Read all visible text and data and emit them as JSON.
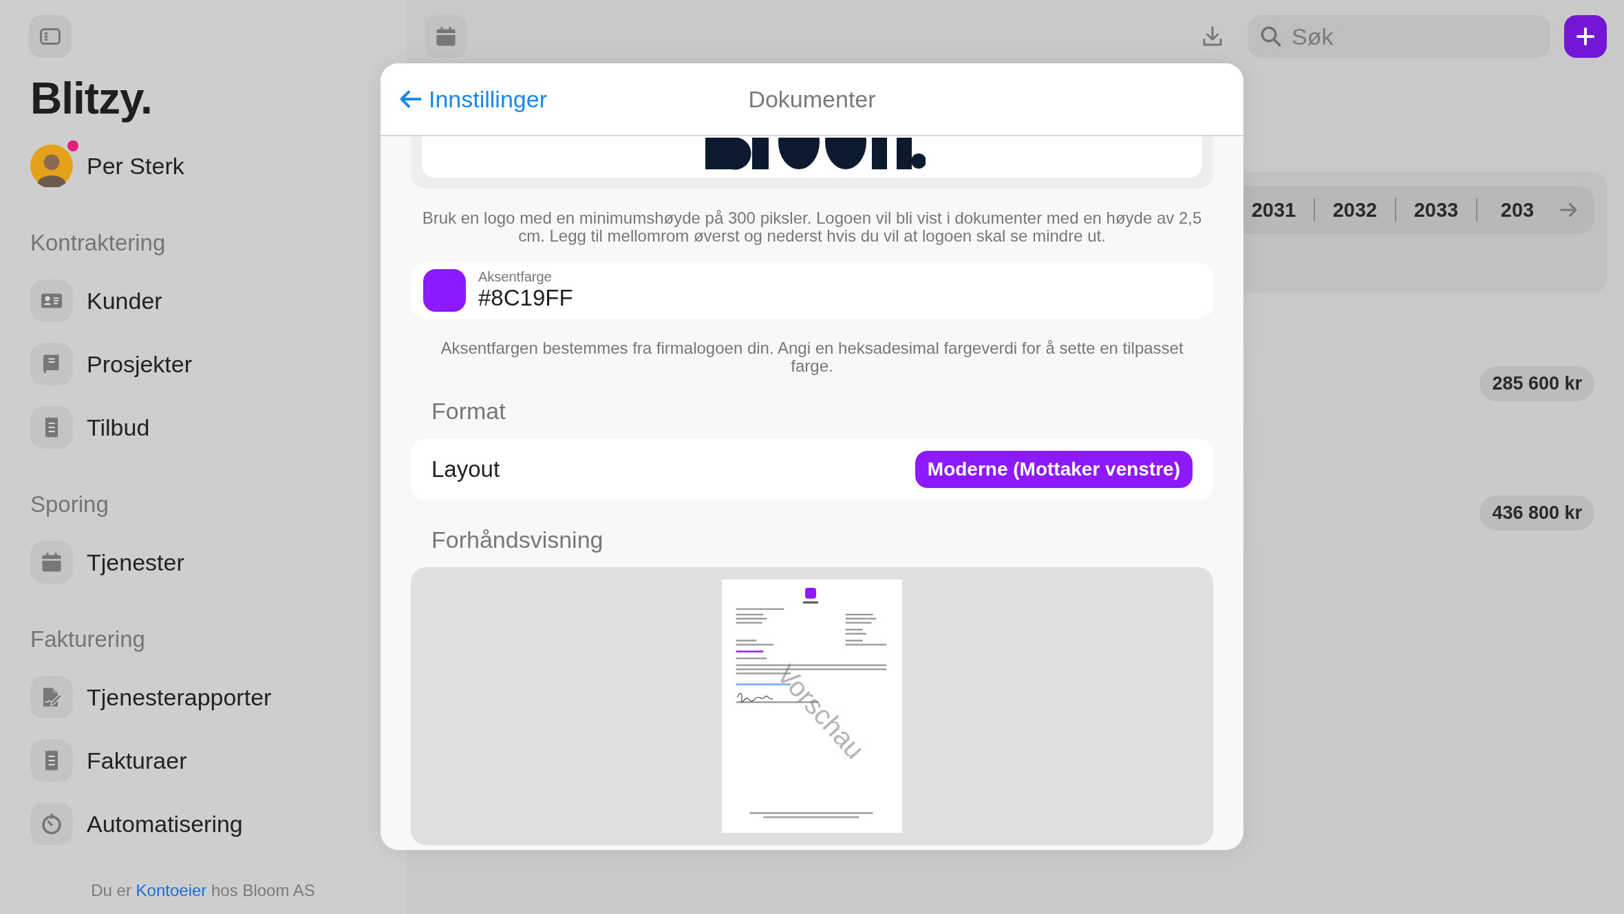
{
  "sidebar": {
    "title": "Blitzy.",
    "user": {
      "name": "Per Sterk",
      "notification": true
    },
    "sections": [
      {
        "heading": "Kontraktering",
        "items": [
          {
            "label": "Kunder"
          },
          {
            "label": "Prosjekter"
          },
          {
            "label": "Tilbud"
          }
        ]
      },
      {
        "heading": "Sporing",
        "items": [
          {
            "label": "Tjenester"
          }
        ]
      },
      {
        "heading": "Fakturering",
        "items": [
          {
            "label": "Tjenesterapporter"
          },
          {
            "label": "Fakturaer"
          },
          {
            "label": "Automatisering"
          }
        ]
      }
    ],
    "footer": {
      "before": "Du er",
      "link": "Kontoeier",
      "after": "hos Bloom AS"
    }
  },
  "toolbar": {
    "search": {
      "placeholder": "Søk"
    }
  },
  "background": {
    "years": [
      "2031",
      "2032",
      "2033",
      "203"
    ],
    "amounts": [
      "285 600 kr",
      "436 800 kr"
    ]
  },
  "dialog": {
    "back": "Innstillinger",
    "title": "Dokumenter",
    "logo_help": "Bruk en logo med en minimumshøyde på 300 piksler. Logoen vil bli vist i dokumenter med en høyde av 2,5 cm. Legg til mellomrom øverst og nederst hvis du vil at logoen skal se mindre ut.",
    "accent": {
      "label": "Aksentfarge",
      "value": "#8C19FF",
      "color": "#8c19ff"
    },
    "accent_help": "Aksentfargen bestemmes fra firmalogoen din. Angi en heksadesimal fargeverdi for å sette en tilpasset farge.",
    "format_heading": "Format",
    "layout": {
      "label": "Layout",
      "value": "Moderne (Mottaker venstre)"
    },
    "preview_heading": "Forhåndsvisning",
    "preview": {
      "watermark": "Vorschau"
    }
  }
}
